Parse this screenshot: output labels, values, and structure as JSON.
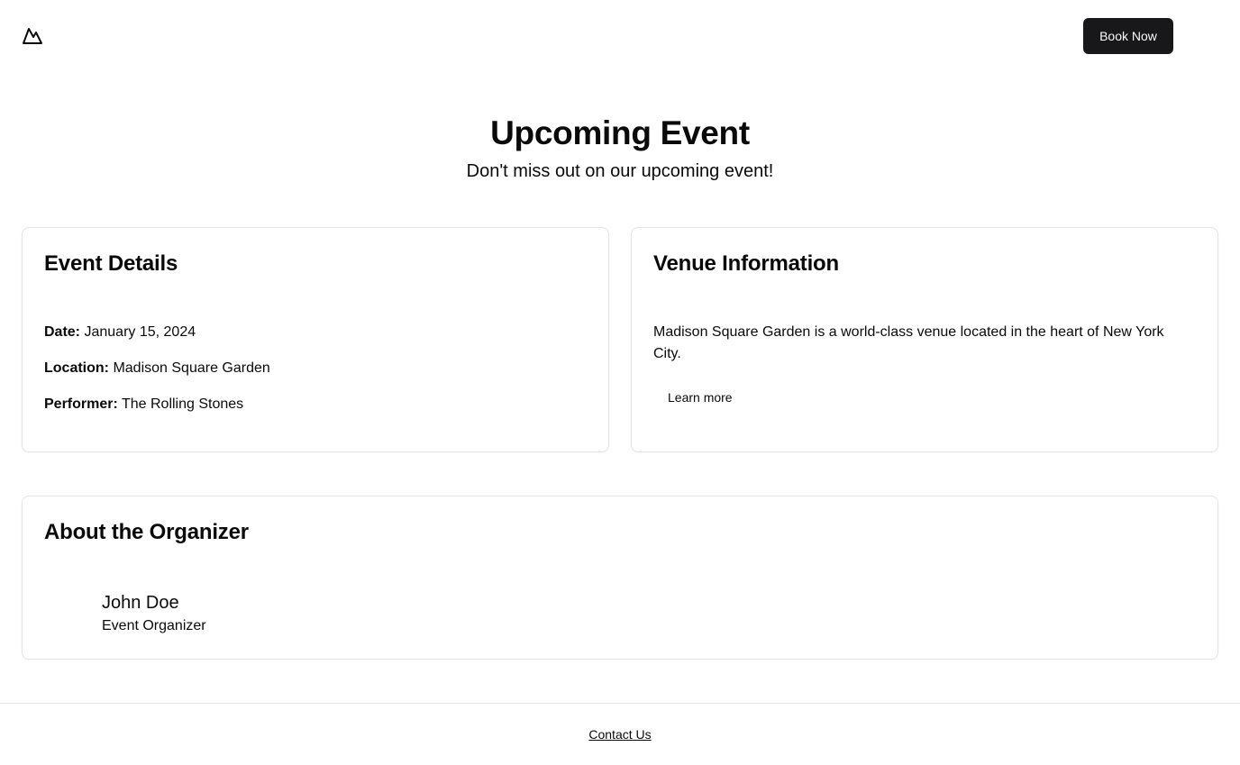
{
  "header": {
    "logo_icon": "mountain-icon",
    "book_now_label": "Book Now"
  },
  "hero": {
    "title": "Upcoming Event",
    "subtitle": "Don't miss out on our upcoming event!"
  },
  "event_details": {
    "title": "Event Details",
    "date_label": "Date:",
    "date_value": "January 15, 2024",
    "location_label": "Location:",
    "location_value": "Madison Square Garden",
    "performer_label": "Performer:",
    "performer_value": "The Rolling Stones"
  },
  "venue": {
    "title": "Venue Information",
    "description": "Madison Square Garden is a world-class venue located in the heart of New York City.",
    "learn_more_label": "Learn more"
  },
  "organizer": {
    "title": "About the Organizer",
    "name": "John Doe",
    "role": "Event Organizer"
  },
  "footer": {
    "contact_label": "Contact Us"
  },
  "colors": {
    "primary_button": "#18181b",
    "border": "#e4e4e7",
    "text": "#0a0a0a"
  }
}
